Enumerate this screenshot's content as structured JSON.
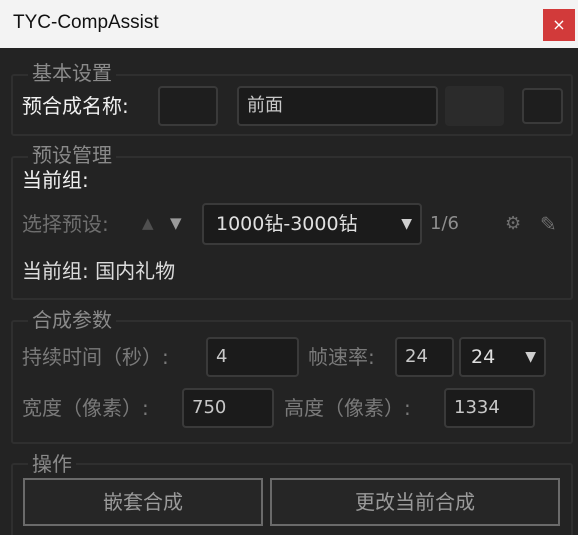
{
  "window": {
    "title": "TYC-CompAssist",
    "close_glyph": "×"
  },
  "basic": {
    "legend": "基本设置",
    "name_label": "预合成名称:",
    "name_value": "前面"
  },
  "presets": {
    "legend": "预设管理",
    "current_group_label": "当前组:",
    "select_label": "选择预设:",
    "up_glyph": "▲",
    "down_glyph": "▼",
    "selected": "1000钻-3000钻",
    "counter": "1/6",
    "settings_glyph": "⚙",
    "edit_glyph": "✎",
    "current_group_display": "当前组: 国内礼物"
  },
  "comp": {
    "legend": "合成参数",
    "duration_label": "持续时间（秒）:",
    "duration_value": "4",
    "fps_label": "帧速率:",
    "fps_value": "24",
    "fps_select": "24",
    "width_label": "宽度（像素）:",
    "width_value": "750",
    "height_label": "高度（像素）:",
    "height_value": "1334"
  },
  "actions": {
    "legend": "操作",
    "nest_label": "嵌套合成",
    "change_label": "更改当前合成"
  }
}
